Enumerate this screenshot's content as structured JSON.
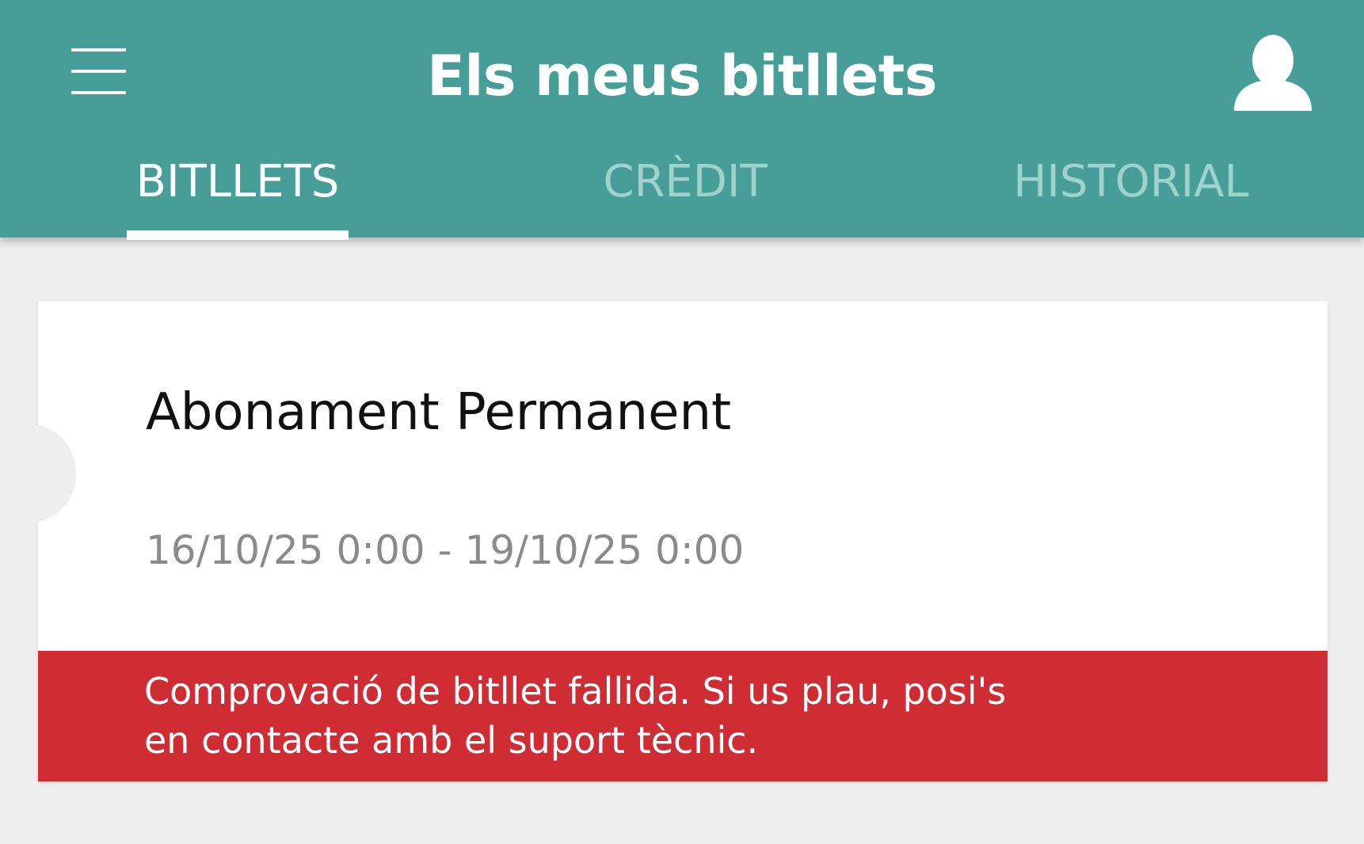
{
  "header": {
    "title": "Els meus bitllets",
    "menu_icon": "hamburger-menu-icon",
    "profile_icon": "user-profile-icon"
  },
  "tabs": [
    {
      "label": "BITLLETS",
      "active": true
    },
    {
      "label": "CRÈDIT",
      "active": false
    },
    {
      "label": "HISTORIAL",
      "active": false
    }
  ],
  "ticket": {
    "title": "Abonament Permanent",
    "validity": "16/10/25 0:00 - 19/10/25 0:00",
    "error_message_line1": "Comprovació de bitllet fallida. Si us plau, posi's",
    "error_message_line2": "en contacte amb el suport tècnic."
  },
  "colors": {
    "header_background": "#479e99",
    "active_tab": "#ffffff",
    "inactive_tab": "#9fd1cd",
    "page_background": "#efeeee",
    "error_banner": "#cf2c33"
  }
}
